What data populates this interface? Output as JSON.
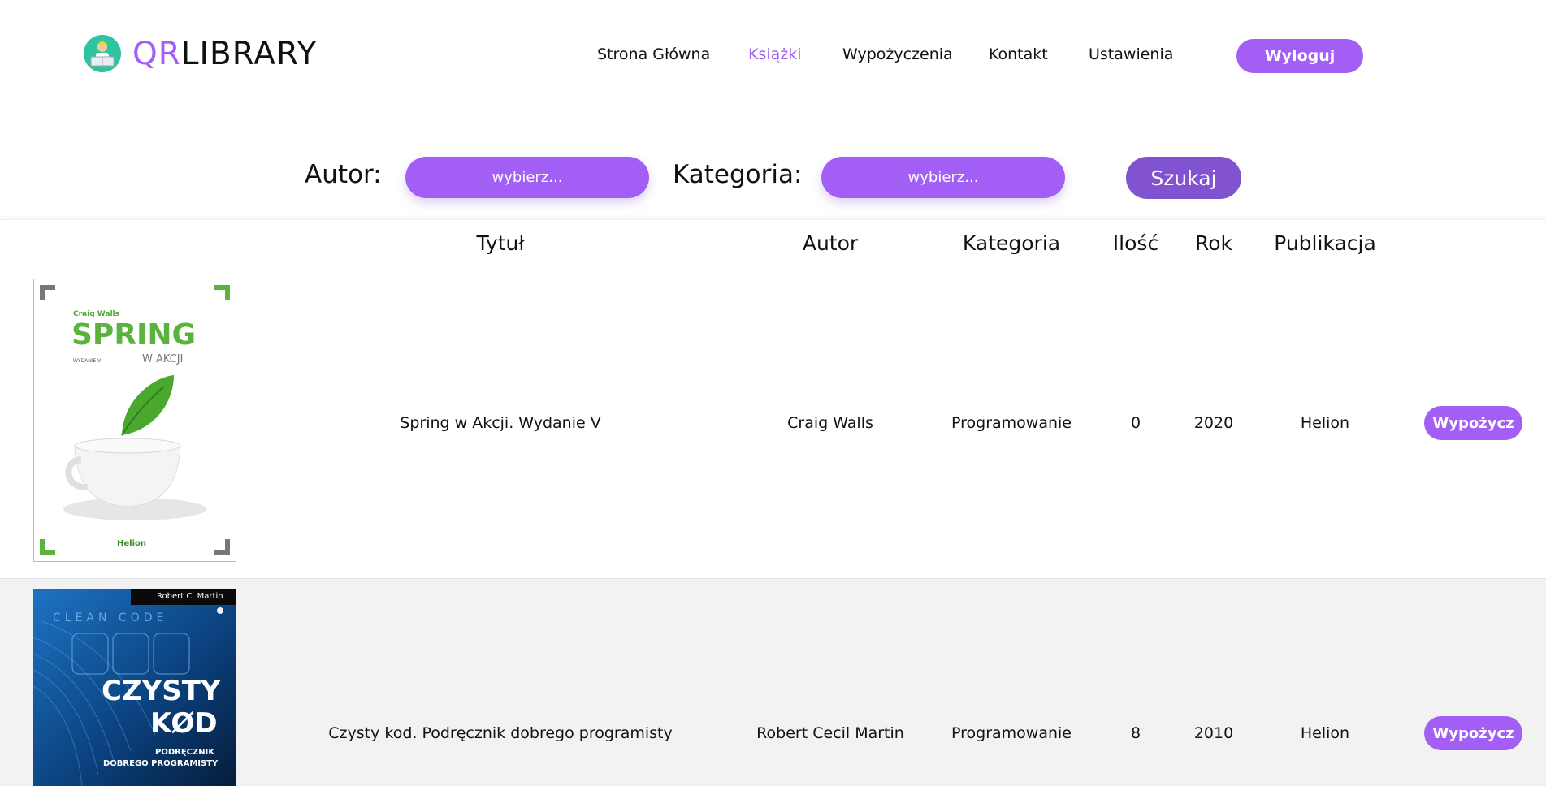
{
  "brand": {
    "logo_qr": "QR",
    "logo_library": "LIBRARY",
    "accent": "#a25ef5"
  },
  "nav": {
    "items": [
      {
        "label": "Strona Główna",
        "active": false
      },
      {
        "label": "Książki",
        "active": true
      },
      {
        "label": "Wypożyczenia",
        "active": false
      },
      {
        "label": "Kontakt",
        "active": false
      },
      {
        "label": "Ustawienia",
        "active": false
      }
    ],
    "logout_label": "Wyloguj"
  },
  "filters": {
    "author_label": "Autor:",
    "author_select": "wybierz...",
    "category_label": "Kategoria:",
    "category_select": "wybierz...",
    "search_label": "Szukaj"
  },
  "table": {
    "headers": [
      "Tytuł",
      "Autor",
      "Kategoria",
      "Ilość",
      "Rok",
      "Publikacja"
    ],
    "rows": [
      {
        "title": "Spring w Akcji. Wydanie V",
        "author": "Craig Walls",
        "category": "Programowanie",
        "quantity": "0",
        "year": "2020",
        "publisher": "Helion",
        "action": "Wypożycz",
        "cover": {
          "author": "Craig Walls",
          "title": "SPRING",
          "subtitle": "W AKCJI",
          "edition": "WYDANIE V",
          "publisher": "Helion"
        }
      },
      {
        "title": "Czysty kod. Podręcznik dobrego programisty",
        "author": "Robert Cecil Martin",
        "category": "Programowanie",
        "quantity": "8",
        "year": "2010",
        "publisher": "Helion",
        "action": "Wypożycz",
        "cover": {
          "author": "Robert C. Martin",
          "bg_text": "CLEAN CODE",
          "title_line1": "CZYSTY",
          "title_line2": "KØD",
          "subtitle_line1": "PODRĘCZNIK",
          "subtitle_line2": "DOBREGO PROGRAMISTY"
        }
      }
    ]
  }
}
